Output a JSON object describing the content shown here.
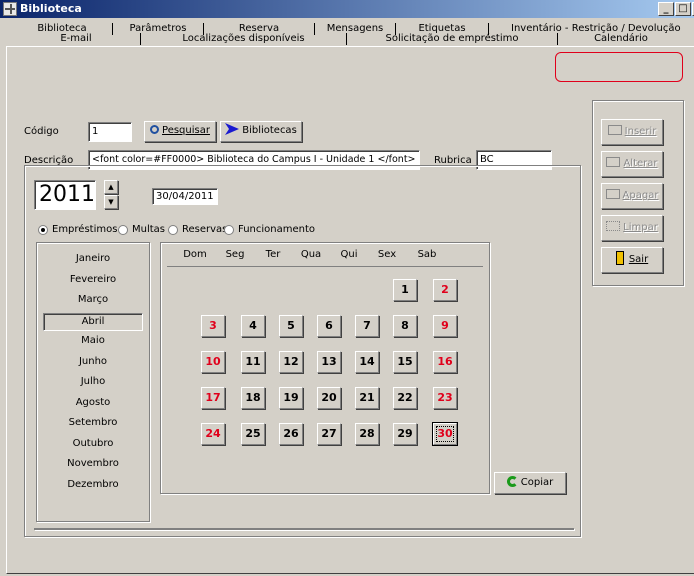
{
  "window": {
    "title": "Biblioteca",
    "controls": [
      "_",
      "□",
      "×"
    ]
  },
  "tabs_row1": [
    "Biblioteca",
    "Parâmetros",
    "Reserva",
    "Mensagens",
    "Etiquetas",
    "Inventário - Restrição / Devolução"
  ],
  "tabs_row2": [
    "E-mail",
    "Localizações disponíveis",
    "Solicitação de empréstimo",
    "Calendário"
  ],
  "active_tab": "Calendário",
  "form": {
    "codigo_label": "Código",
    "codigo_value": "1",
    "pesquisar_label": "Pesquisar",
    "bibliotecas_label": "Bibliotecas",
    "descricao_label": "Descrição",
    "descricao_value": "<font color=#FF0000> Biblioteca do Campus I - Unidade 1 </font>",
    "rubrica_label": "Rubrica",
    "rubrica_value": "BC"
  },
  "side_actions": {
    "inserir": "Inserir",
    "alterar": "Alterar",
    "apagar": "Apagar",
    "limpar": "Limpar",
    "sair": "Sair"
  },
  "calendar": {
    "year": "2011",
    "date": "30/04/2011",
    "radios": [
      "Empréstimos",
      "Multas",
      "Reservas",
      "Funcionamento"
    ],
    "selected_radio": "Empréstimos",
    "months": [
      "Janeiro",
      "Fevereiro",
      "Março",
      "Abril",
      "Maio",
      "Junho",
      "Julho",
      "Agosto",
      "Setembro",
      "Outubro",
      "Novembro",
      "Dezembro"
    ],
    "selected_month": "Abril",
    "weekdays": [
      "Dom",
      "Seg",
      "Ter",
      "Qua",
      "Qui",
      "Sex",
      "Sab"
    ],
    "weeks": [
      [
        "",
        "",
        "",
        "",
        "",
        "1",
        "2"
      ],
      [
        "3",
        "4",
        "5",
        "6",
        "7",
        "8",
        "9"
      ],
      [
        "10",
        "11",
        "12",
        "13",
        "14",
        "15",
        "16"
      ],
      [
        "17",
        "18",
        "19",
        "20",
        "21",
        "22",
        "23"
      ],
      [
        "24",
        "25",
        "26",
        "27",
        "28",
        "29",
        "30"
      ]
    ],
    "selected_day": "30",
    "copiar_label": "Copiar"
  },
  "colors": {
    "holiday": "#e0001b",
    "highlight_ring": "#e0001b",
    "titlebar": "#0a246a"
  }
}
